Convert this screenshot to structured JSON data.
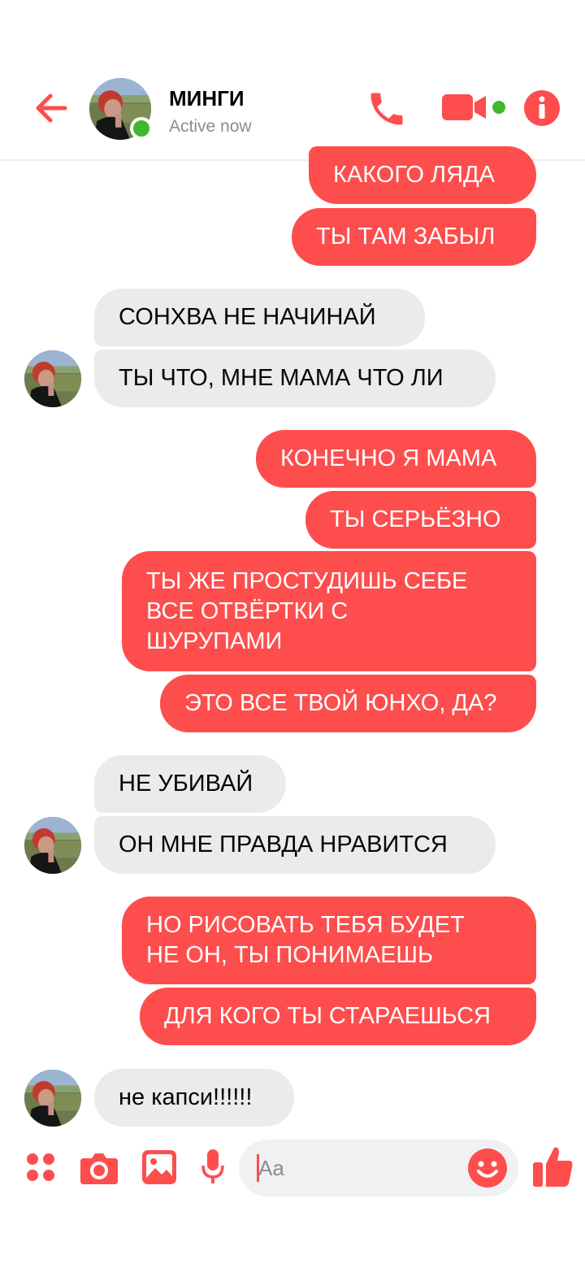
{
  "header": {
    "name": "МИНГИ",
    "status": "Active now"
  },
  "messages": [
    {
      "side": "me",
      "text": "КАКОГО ЛЯДА"
    },
    {
      "side": "me",
      "text": "ТЫ ТАМ ЗАБЫЛ"
    },
    {
      "side": "them",
      "text": "СОНХВА НЕ НАЧИНАЙ"
    },
    {
      "side": "them",
      "text": "ТЫ ЧТО, МНЕ МАМА ЧТО ЛИ"
    },
    {
      "side": "me",
      "text": "КОНЕЧНО Я МАМА"
    },
    {
      "side": "me",
      "text": "ТЫ СЕРЬЁЗНО"
    },
    {
      "side": "me",
      "text": "ТЫ ЖЕ ПРОСТУДИШЬ СЕБЕ ВСЕ ОТВЁРТКИ С ШУРУПАМИ"
    },
    {
      "side": "me",
      "text": "ЭТО ВСЕ ТВОЙ ЮНХО, ДА?"
    },
    {
      "side": "them",
      "text": "НЕ УБИВАЙ"
    },
    {
      "side": "them",
      "text": "ОН МНЕ ПРАВДА НРАВИТСЯ"
    },
    {
      "side": "me",
      "text": "НО РИСОВАТЬ ТЕБЯ БУДЕТ НЕ ОН, ТЫ ПОНИМАЕШЬ"
    },
    {
      "side": "me",
      "text": "ДЛЯ КОГО ТЫ СТАРАЕШЬСЯ"
    },
    {
      "side": "them",
      "text": "не капси!!!!!!"
    }
  ],
  "composer": {
    "placeholder": "Aa"
  },
  "colors": {
    "accent": "#fe4d4d",
    "incoming_bubble": "#ebebed",
    "online": "#42b72a"
  },
  "icons": [
    "back-arrow-icon",
    "phone-icon",
    "video-camera-icon",
    "info-icon",
    "apps-icon",
    "camera-icon",
    "gallery-icon",
    "microphone-icon",
    "emoji-icon",
    "thumbs-up-icon"
  ]
}
